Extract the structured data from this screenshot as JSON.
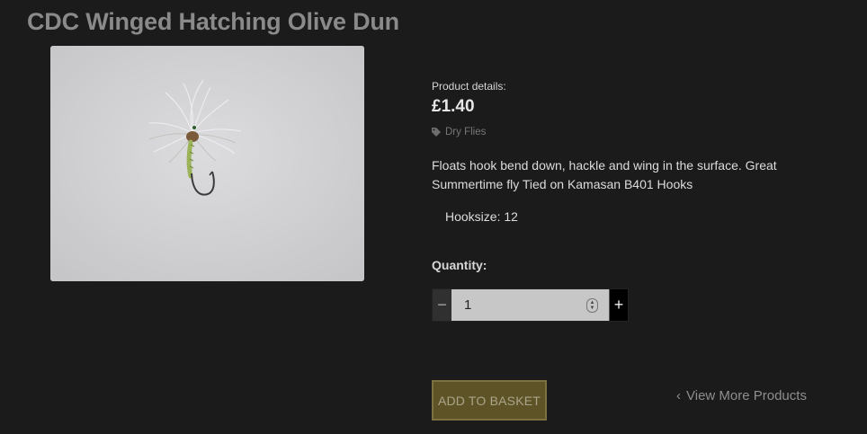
{
  "product": {
    "title": "CDC Winged Hatching Olive Dun",
    "details_label": "Product details:",
    "price": "£1.40",
    "category": "Dry Flies",
    "description": "Floats hook bend down, hackle and wing in the surface. Great Summertime fly Tied on Kamasan B401 Hooks",
    "hooksize": "Hooksize: 12"
  },
  "quantity": {
    "label": "Quantity:",
    "value": "1",
    "minus_icon": "minus-icon",
    "plus_icon": "plus-icon"
  },
  "actions": {
    "add_to_basket": "ADD TO BASKET",
    "view_more": "View More Products"
  },
  "icons": {
    "tag": "tag-icon",
    "chevron": "chevron-left-icon"
  },
  "colors": {
    "background": "#1b1b1b",
    "button": "#5e5327",
    "title": "#8a8a8a"
  }
}
